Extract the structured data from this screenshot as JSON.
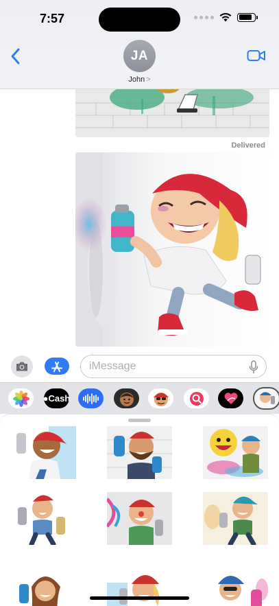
{
  "status_bar": {
    "time": "7:57",
    "battery_level": 0.85
  },
  "header": {
    "avatar_initials": "JA",
    "contact_name": "John",
    "chevron": ">",
    "back_icon": "chevron-left-icon",
    "video_icon": "video-camera-icon"
  },
  "conversation": {
    "delivered_label": "Delivered",
    "messages": [
      {
        "type": "image",
        "subject": "graffiti wall sticker (partially visible)"
      },
      {
        "type": "image",
        "subject": "cartoon girl spraying paint"
      }
    ]
  },
  "input_bar": {
    "placeholder": "iMessage",
    "value": "",
    "camera_icon": "camera-icon",
    "apps_icon": "app-store-icon",
    "mic_icon": "microphone-icon"
  },
  "app_strip": {
    "apps": [
      {
        "name": "Photos",
        "icon": "photos-icon"
      },
      {
        "name": "Apple Cash",
        "label": "Cash",
        "icon": "apple-cash-icon"
      },
      {
        "name": "Audio",
        "icon": "audio-waveform-icon"
      },
      {
        "name": "Memoji",
        "icon": "memoji-icon"
      },
      {
        "name": "Memoji Stickers",
        "icon": "memoji-stickers-icon"
      },
      {
        "name": "Images",
        "icon": "image-search-icon"
      },
      {
        "name": "Digital Touch",
        "icon": "digital-touch-icon"
      },
      {
        "name": "Sticker App",
        "icon": "sticker-app-icon",
        "selected": true
      }
    ]
  },
  "sticker_drawer": {
    "stickers": [
      {
        "subject": "graffiti boy with cap and spray can"
      },
      {
        "subject": "bearded man spraying graffiti"
      },
      {
        "subject": "yellow face with graffiti kid"
      },
      {
        "subject": "boy with spray cans"
      },
      {
        "subject": "clown-faced sprayer at graffiti wall"
      },
      {
        "subject": "boy in teal cap spraying"
      },
      {
        "subject": "girl with spray can"
      },
      {
        "subject": "girl in red cap spraying"
      },
      {
        "subject": "man in blue cap spraying"
      }
    ]
  },
  "colors": {
    "accent": "#2f7cf6",
    "avatar_gray": "#9a9ca4",
    "app_strip_bg": "#e3e4e8"
  }
}
